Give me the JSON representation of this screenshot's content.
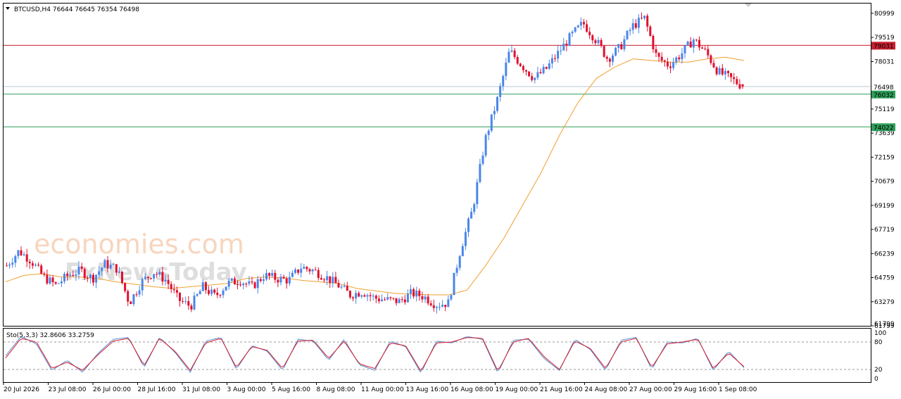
{
  "header": {
    "symbol_label": "BTCUSD,H4  76644 76645 76354 76498"
  },
  "indicator": {
    "label": "Sto(5,3,3) 32.8606 33.2759",
    "levels": [
      "100",
      "80",
      "20",
      "0"
    ]
  },
  "watermark": {
    "brand1": "economies.com",
    "brand2": "FxNewsToday"
  },
  "colors": {
    "bull": "#4a86e8",
    "bear": "#e0102e",
    "ma": "#f0a030",
    "resistance": "#c81e30",
    "support": "#2e9e5a",
    "current": "#b9c4d6",
    "stoch_main": "#5b8fd6",
    "stoch_signal": "#d21a2a"
  },
  "price_axis_labels": [
    "80999",
    "79519",
    "78031",
    "76498",
    "75119",
    "73639",
    "72159",
    "70679",
    "69199",
    "67719",
    "66239",
    "64759",
    "63279",
    "61799"
  ],
  "chart_data": {
    "type": "candlestick",
    "symbol": "BTCUSD",
    "timeframe": "H4",
    "ylim": [
      61799,
      81600
    ],
    "x_tick_labels": [
      "20 Jul 2026",
      "23 Jul 08:00",
      "26 Jul 00:00",
      "28 Jul 16:00",
      "31 Jul 08:00",
      "3 Aug 00:00",
      "5 Aug 16:00",
      "8 Aug 08:00",
      "11 Aug 00:00",
      "13 Aug 16:00",
      "16 Aug 08:00",
      "19 Aug 00:00",
      "21 Aug 16:00",
      "24 Aug 08:00",
      "27 Aug 00:00",
      "29 Aug 16:00",
      "1 Sep 08:00"
    ],
    "price_levels": [
      {
        "name": "resistance",
        "value": 79031,
        "label": "79031"
      },
      {
        "name": "current",
        "value": 76498,
        "label": "76498"
      },
      {
        "name": "support1",
        "value": 76032,
        "label": "76032"
      },
      {
        "name": "support2",
        "value": 74022,
        "label": "74022"
      }
    ],
    "last": {
      "open": 76644,
      "high": 76645,
      "low": 76354,
      "close": 76498
    },
    "close_path": [
      65500,
      66400,
      65800,
      64800,
      64300,
      64900,
      65200,
      64700,
      65600,
      65300,
      63200,
      64500,
      65100,
      64600,
      63400,
      63000,
      64200,
      63600,
      64400,
      64600,
      64200,
      64900,
      64700,
      64600,
      65400,
      65200,
      64800,
      64300,
      63700,
      63900,
      63500,
      63400,
      63300,
      63800,
      63600,
      63100,
      63200,
      66500,
      69000,
      73200,
      75700,
      78700,
      77800,
      77000,
      77600,
      78600,
      79600,
      80400,
      79400,
      78200,
      78900,
      80200,
      80700,
      78300,
      77800,
      78500,
      79400,
      78600,
      77400,
      77000,
      76500
    ],
    "ma_path": [
      64500,
      64900,
      65000,
      64800,
      64800,
      64700,
      64500,
      64350,
      64200,
      64100,
      64200,
      64300,
      64400,
      64700,
      64800,
      64750,
      64600,
      64500,
      64400,
      64100,
      63950,
      63800,
      63750,
      63700,
      63700,
      64000,
      65500,
      67200,
      69200,
      71200,
      73500,
      75500,
      77000,
      77700,
      78200,
      78100,
      78000,
      78000,
      78200,
      78300,
      78100
    ],
    "stoch_main_path": [
      50,
      92,
      76,
      18,
      40,
      14,
      55,
      86,
      90,
      24,
      90,
      58,
      14,
      82,
      90,
      20,
      72,
      60,
      18,
      86,
      82,
      40,
      86,
      30,
      18,
      82,
      70,
      12,
      82,
      78,
      92,
      86,
      12,
      84,
      86,
      44,
      18,
      86,
      64,
      18,
      84,
      90,
      20,
      80,
      78,
      88,
      18,
      60,
      24
    ],
    "stoch_signal_path": [
      45,
      88,
      80,
      22,
      36,
      18,
      52,
      82,
      88,
      28,
      88,
      60,
      18,
      78,
      88,
      24,
      70,
      62,
      22,
      82,
      84,
      44,
      82,
      32,
      22,
      78,
      72,
      16,
      78,
      80,
      90,
      88,
      16,
      80,
      88,
      48,
      20,
      82,
      66,
      22,
      80,
      88,
      24,
      76,
      80,
      86,
      22,
      56,
      26
    ]
  }
}
